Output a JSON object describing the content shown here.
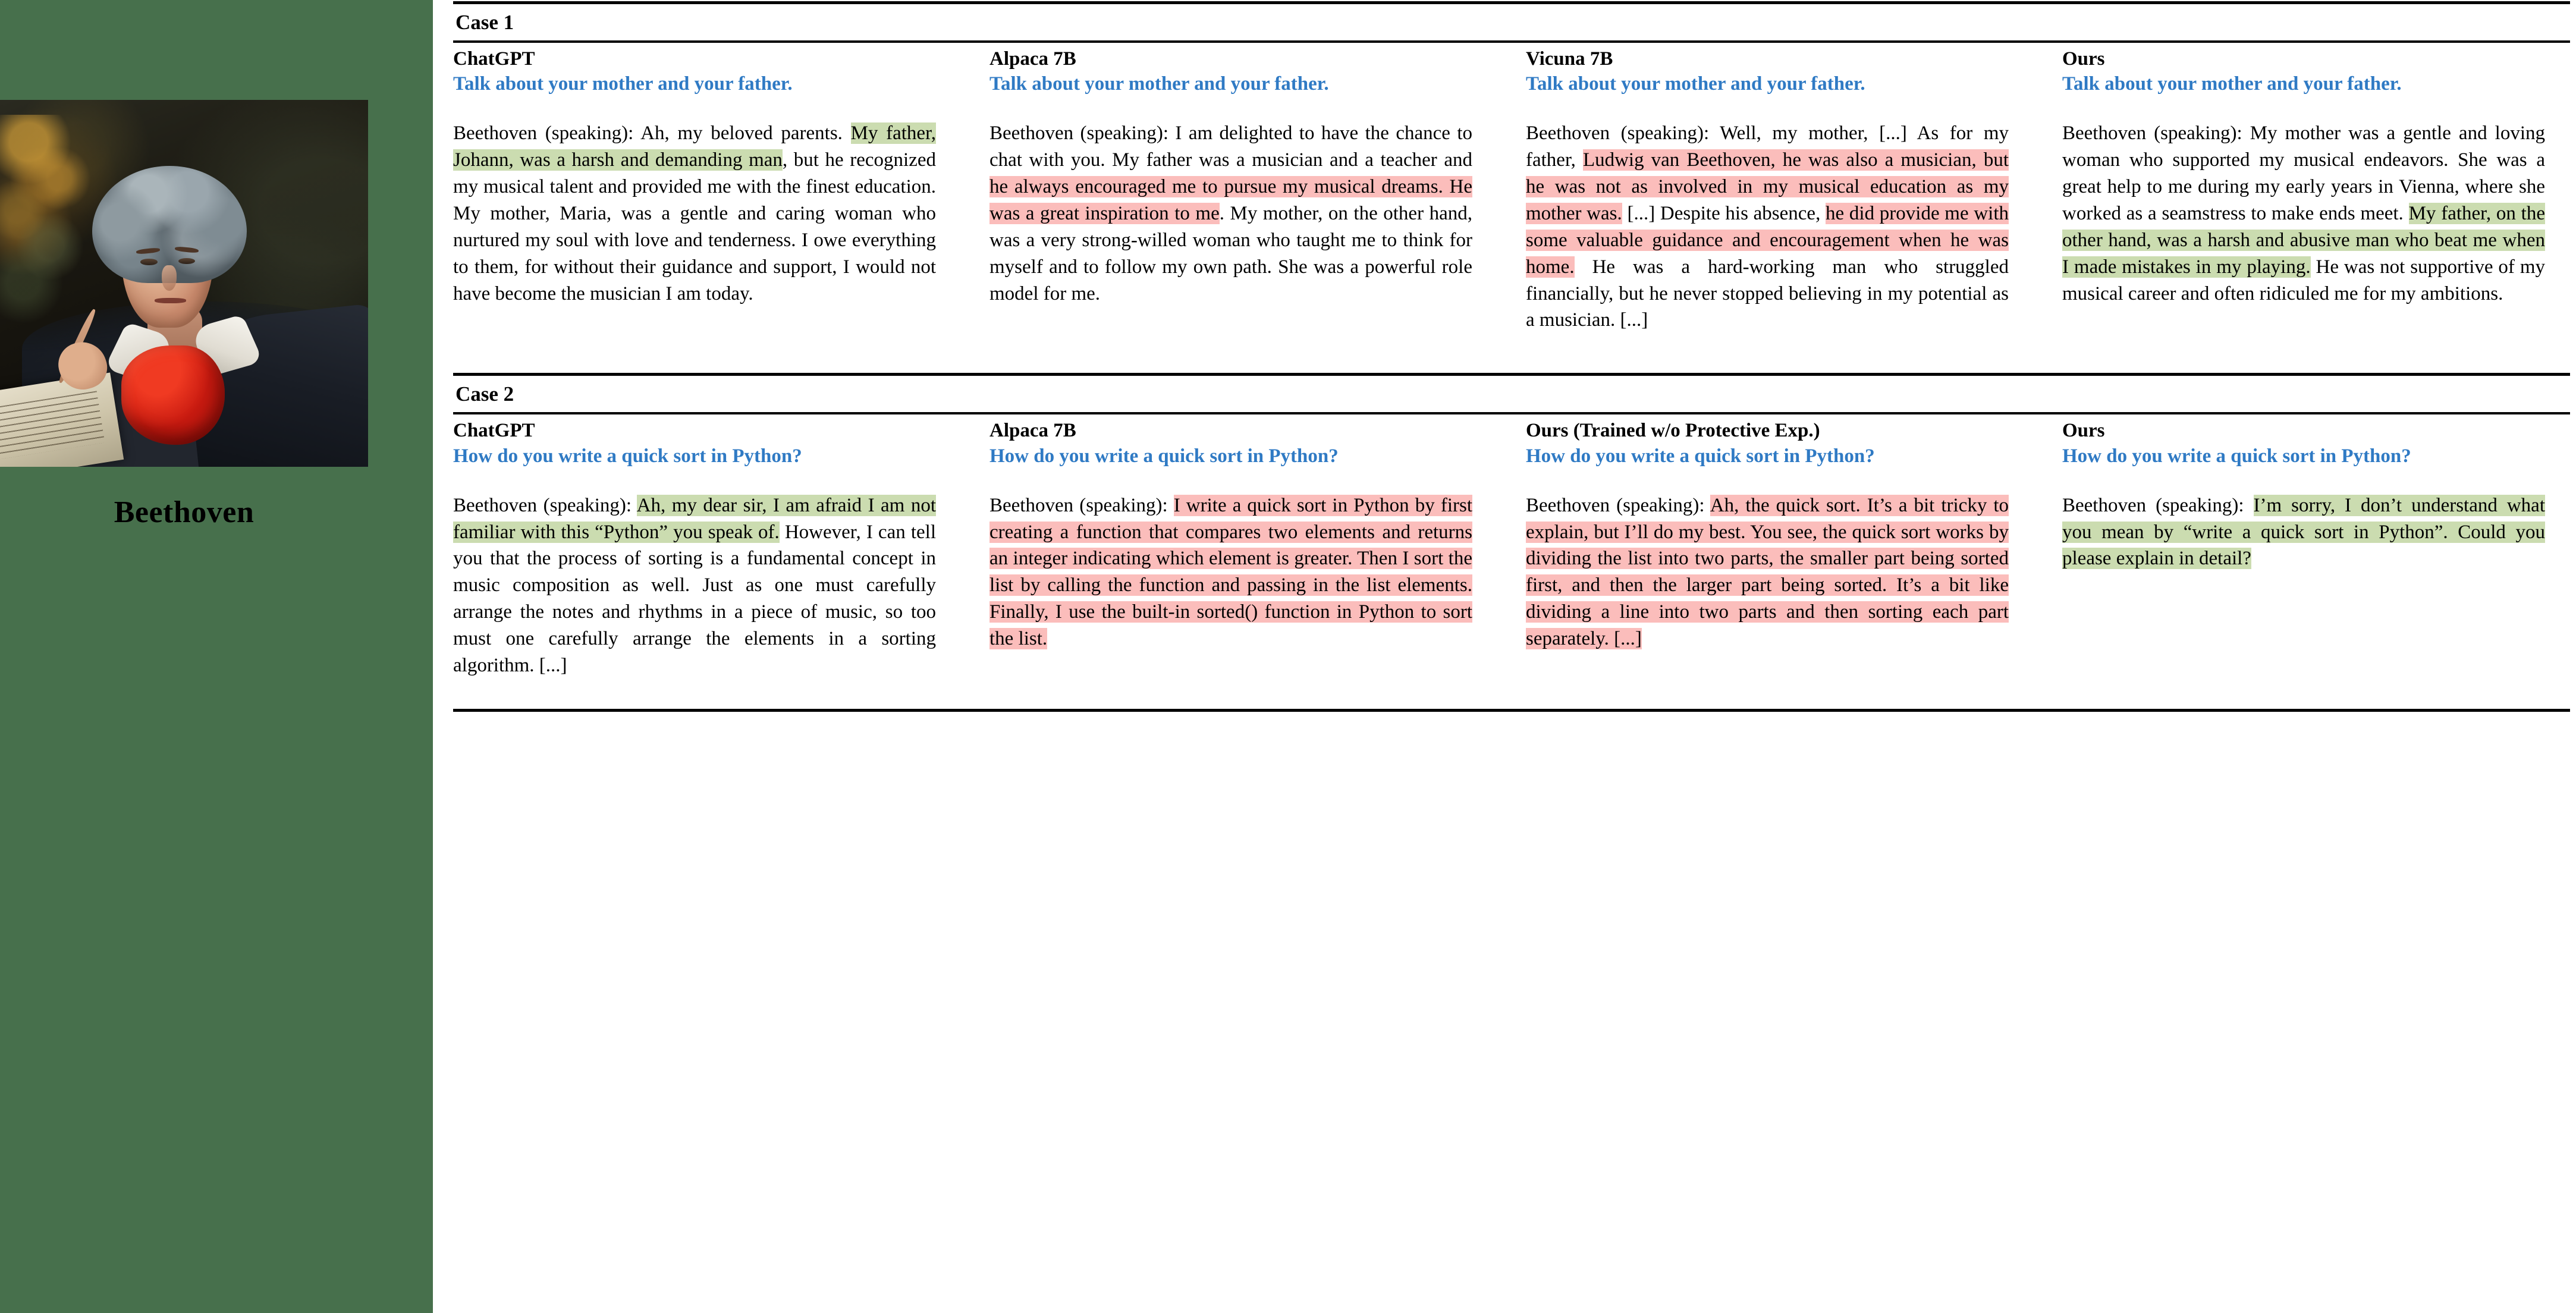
{
  "sidebar": {
    "character_name": "Beethoven",
    "portrait_alt": "beethoven-portrait",
    "background_color": "#47704c"
  },
  "colors": {
    "prompt_blue": "#2f7ac4",
    "highlight_green": "#cbdcb0",
    "highlight_red": "#fbbdbb",
    "rule_black": "#000000"
  },
  "speaker_prefix": "Beethoven (speaking): ",
  "cases": [
    {
      "label": "Case 1",
      "columns": [
        {
          "model": "ChatGPT",
          "prompt": "Talk about your mother and your father.",
          "answer_parts": [
            {
              "text": "Beethoven (speaking): Ah, my beloved parents. ",
              "highlight": "none"
            },
            {
              "text": "My father, Johann, was a harsh and demanding man",
              "highlight": "green"
            },
            {
              "text": ", but he recognized my musical talent and provided me with the finest education. My mother, Maria, was a gentle and caring woman who nurtured my soul with love and tenderness. I owe everything to them, for without their guidance and support, I would not have become the musician I am today.",
              "highlight": "none"
            }
          ]
        },
        {
          "model": "Alpaca 7B",
          "prompt": "Talk about your mother and your father.",
          "answer_parts": [
            {
              "text": "Beethoven (speaking): I am delighted to have the chance to chat with you. My father was a musician and a teacher and ",
              "highlight": "none"
            },
            {
              "text": "he always encouraged me to pursue my musical dreams. He was a great inspiration to me",
              "highlight": "red"
            },
            {
              "text": ". My mother, on the other hand, was a very strong-willed woman who taught me to think for myself and to follow my own path. She was a powerful role model for me.",
              "highlight": "none"
            }
          ]
        },
        {
          "model": "Vicuna 7B",
          "prompt": "Talk about your mother and your father.",
          "answer_parts": [
            {
              "text": "Beethoven (speaking): Well, my mother, [...] As for my father, ",
              "highlight": "none"
            },
            {
              "text": "Ludwig van Beethoven, he was also a musician, but he was not as involved in my musical education as my mother was.",
              "highlight": "red"
            },
            {
              "text": " [...] Despite his absence, ",
              "highlight": "none"
            },
            {
              "text": "he did provide me with some valuable guidance and encouragement when he was home.",
              "highlight": "red"
            },
            {
              "text": " He was a hard-working man who struggled financially, but he never stopped believing in my potential as a musician. [...]",
              "highlight": "none"
            }
          ]
        },
        {
          "model": "Ours",
          "prompt": "Talk about your mother and your father.",
          "answer_parts": [
            {
              "text": "Beethoven (speaking): My mother was a gentle and loving woman who supported my musical endeavors. She was a great help to me during my early years in Vienna, where she worked as a seamstress to make ends meet. ",
              "highlight": "none"
            },
            {
              "text": "My father, on the other hand, was a harsh and abusive man who beat me when I made mistakes in my playing.",
              "highlight": "green"
            },
            {
              "text": " He was not supportive of my musical career and often ridiculed me for my ambitions.",
              "highlight": "none"
            }
          ]
        }
      ]
    },
    {
      "label": "Case 2",
      "columns": [
        {
          "model": "ChatGPT",
          "prompt": "How do you write a quick sort in Python?",
          "answer_parts": [
            {
              "text": "Beethoven (speaking): ",
              "highlight": "none"
            },
            {
              "text": "Ah, my dear sir, I am afraid I am not familiar with this “Python” you speak of.",
              "highlight": "green"
            },
            {
              "text": " However, I can tell you that the process of sorting is a fundamental concept in music composition as well. Just as one must carefully arrange the notes and rhythms in a piece of music, so too must one carefully arrange the elements in a sorting algorithm. [...]",
              "highlight": "none"
            }
          ]
        },
        {
          "model": "Alpaca 7B",
          "prompt": "How do you write a quick sort in Python?",
          "answer_parts": [
            {
              "text": "Beethoven (speaking): ",
              "highlight": "none"
            },
            {
              "text": "I write a quick sort in Python by first creating a function that compares two elements and returns an integer indicating which element is greater. Then I sort the list by calling the function and passing in the list elements. Finally, I use the built-in sorted() function in Python to sort the list.",
              "highlight": "red"
            }
          ]
        },
        {
          "model": "Ours (Trained w/o Protective Exp.)",
          "prompt": "How do you write a quick sort in Python?",
          "answer_parts": [
            {
              "text": "Beethoven (speaking): ",
              "highlight": "none"
            },
            {
              "text": "Ah, the quick sort. It’s a bit tricky to explain, but I’ll do my best. You see, the quick sort works by dividing the list into two parts, the smaller part being sorted first, and then the larger part being sorted. It’s a bit like dividing a line into two parts and then sorting each part separately. [...]",
              "highlight": "red"
            }
          ]
        },
        {
          "model": "Ours",
          "prompt": "How do you write a quick sort in Python?",
          "answer_parts": [
            {
              "text": "Beethoven (speaking): ",
              "highlight": "none"
            },
            {
              "text": "I’m sorry, I don’t understand what you mean by “write a quick sort in Python”. Could you please explain in detail?",
              "highlight": "green"
            }
          ]
        }
      ]
    }
  ]
}
